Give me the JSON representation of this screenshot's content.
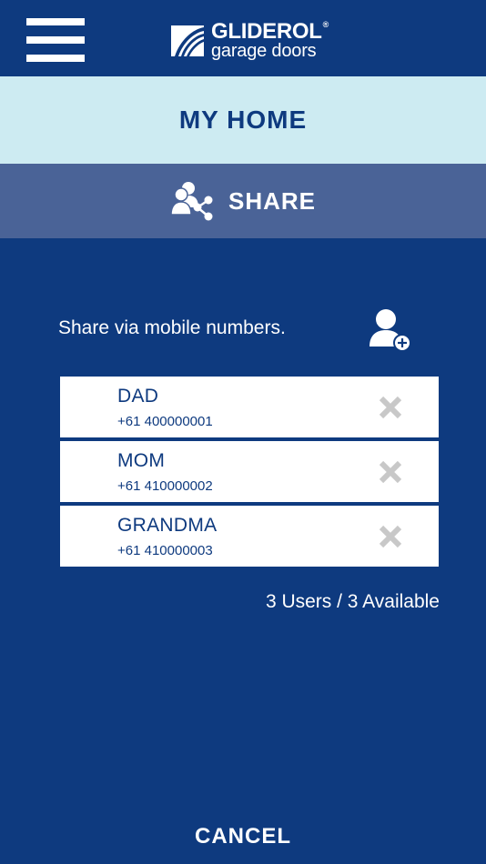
{
  "header": {
    "menu_icon": "hamburger-menu-icon",
    "logo": {
      "brand": "GLIDEROL",
      "registered": "®",
      "tagline": "garage doors"
    }
  },
  "home_bar": {
    "title": "MY HOME"
  },
  "share_bar": {
    "icon": "share-users-icon",
    "title": "SHARE"
  },
  "share_section": {
    "prompt": "Share via mobile numbers.",
    "add_icon": "add-user-icon"
  },
  "users": [
    {
      "name": "DAD",
      "phone": "+61 400000001"
    },
    {
      "name": "MOM",
      "phone": "+61 410000002"
    },
    {
      "name": "GRANDMA",
      "phone": "+61 410000003"
    }
  ],
  "summary": {
    "count_text": "3 Users / 3 Available"
  },
  "footer": {
    "cancel_label": "CANCEL"
  },
  "colors": {
    "background": "#0e3a7f",
    "home_bar": "#cdebf2",
    "share_bar": "#4a6397",
    "row": "#ffffff",
    "remove_icon": "#c8c8c8"
  }
}
